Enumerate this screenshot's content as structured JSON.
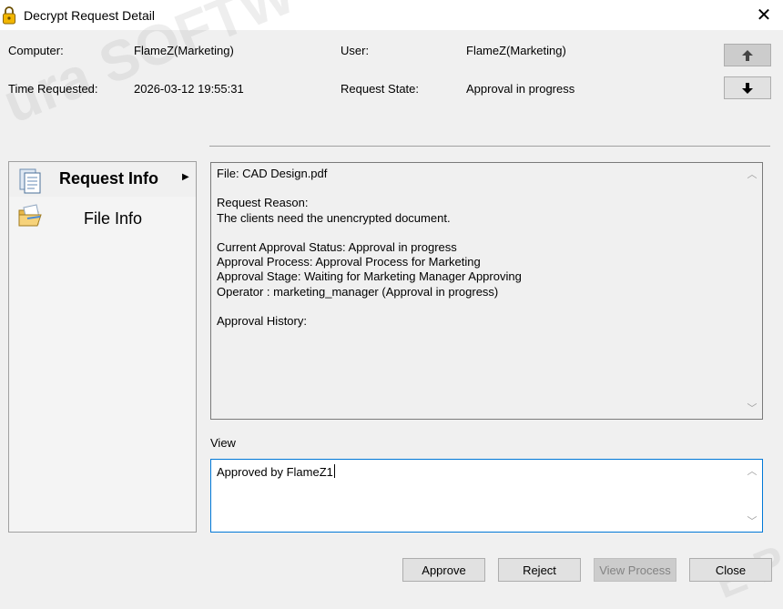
{
  "window": {
    "title": "Decrypt Request Detail",
    "close_glyph": "✕",
    "icon": "lock-icon"
  },
  "watermark": {
    "top_text": "ura SOFTW",
    "bottom_text": "E P"
  },
  "header": {
    "computer_label": "Computer:",
    "computer_value": "FlameZ(Marketing)",
    "user_label": "User:",
    "user_value": "FlameZ(Marketing)",
    "time_label": "Time Requested:",
    "time_value": "2026-03-12 19:55:31",
    "state_label": "Request State:",
    "state_value": "Approval in progress",
    "prev_icon": "arrow-up-icon",
    "next_icon": "arrow-down-icon"
  },
  "sidebar": {
    "items": [
      {
        "label": "Request Info",
        "icon": "document-icon",
        "selected": true,
        "arrow": "▶"
      },
      {
        "label": "File Info",
        "icon": "open-folder-icon",
        "selected": false
      }
    ]
  },
  "content": {
    "lines": [
      "File: CAD Design.pdf",
      "",
      "Request Reason:",
      "The clients need the unencrypted document.",
      "",
      "Current Approval Status: Approval in progress",
      "Approval Process: Approval Process for Marketing",
      "Approval Stage: Waiting for Marketing Manager Approving",
      "Operator : marketing_manager (Approval in progress)",
      "",
      "Approval History:"
    ],
    "scroll_up": "︿",
    "scroll_down": "﹀"
  },
  "view": {
    "label": "View",
    "value": "Approved by FlameZ1"
  },
  "buttons": {
    "approve": "Approve",
    "reject": "Reject",
    "view_process": "View Process",
    "close": "Close"
  },
  "colors": {
    "window_bg": "#f0f0f0",
    "focus_border": "#0078d7",
    "disabled_text": "#838383"
  }
}
